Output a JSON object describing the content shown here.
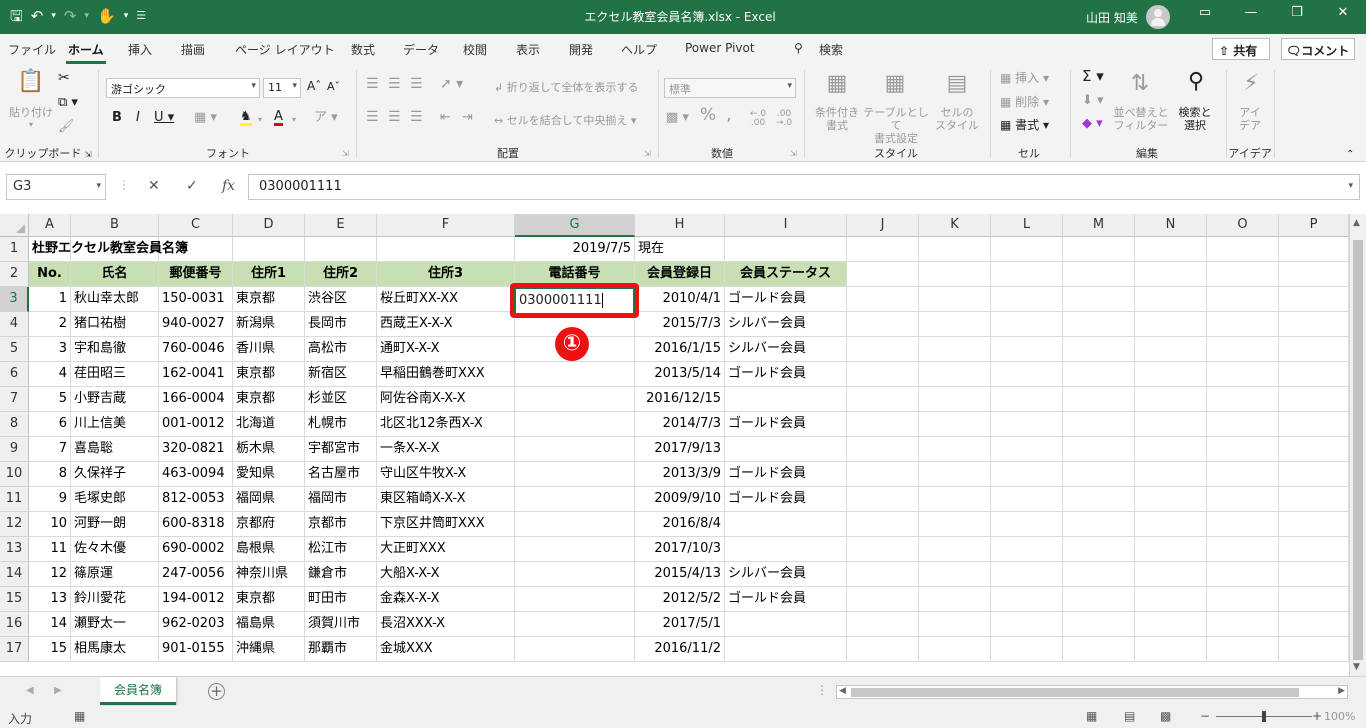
{
  "titlebar": {
    "title": "エクセル教室会員名簿.xlsx  -  Excel",
    "user": "山田 知美",
    "qat_icons": [
      "save-icon",
      "undo-icon",
      "redo-icon",
      "touch-mode-icon",
      "customize-icon"
    ]
  },
  "tabs": [
    "ファイル",
    "ホーム",
    "挿入",
    "描画",
    "ページ レイアウト",
    "数式",
    "データ",
    "校閲",
    "表示",
    "開発",
    "ヘルプ",
    "Power Pivot",
    "検索"
  ],
  "share_label": "共有",
  "comment_label": "コメント",
  "ribbon": {
    "groups": [
      "クリップボード",
      "フォント",
      "配置",
      "数値",
      "スタイル",
      "セル",
      "編集",
      "アイデア"
    ],
    "paste": "貼り付け",
    "font_name": "游ゴシック",
    "font_size": "11",
    "wrap_text": "折り返して全体を表示する",
    "merge_center": "セルを結合して中央揃え",
    "number_format": "標準",
    "conditional_format": "条件付き\n書式",
    "format_as_table": "テーブルとして\n書式設定",
    "cell_styles": "セルの\nスタイル",
    "insert": "挿入",
    "delete": "削除",
    "format": "書式",
    "sort_filter": "並べ替えと\nフィルター",
    "find_select": "検索と\n選択",
    "ideas": "アイ\nデア"
  },
  "formula_bar": {
    "name_box": "G3",
    "formula": "0300001111"
  },
  "columns": [
    "A",
    "B",
    "C",
    "D",
    "E",
    "F",
    "G",
    "H",
    "I",
    "J",
    "K",
    "L",
    "M",
    "N",
    "O",
    "P"
  ],
  "rows": [
    "1",
    "2",
    "3",
    "4",
    "5",
    "6",
    "7",
    "8",
    "9",
    "10",
    "11",
    "12",
    "13",
    "14",
    "15",
    "16",
    "17"
  ],
  "sheet": {
    "title": "杜野エクセル教室会員名簿",
    "date": "2019/7/5",
    "date_suffix": "現在",
    "headers": [
      "No.",
      "氏名",
      "郵便番号",
      "住所1",
      "住所2",
      "住所3",
      "電話番号",
      "会員登録日",
      "会員ステータス"
    ],
    "records": [
      [
        "1",
        "秋山幸太郎",
        "150-0031",
        "東京都",
        "渋谷区",
        "桜丘町XX-XX",
        "0300001111",
        "2010/4/1",
        "ゴールド会員"
      ],
      [
        "2",
        "猪口祐樹",
        "940-0027",
        "新潟県",
        "長岡市",
        "西蔵王X-X-X",
        "",
        "2015/7/3",
        "シルバー会員"
      ],
      [
        "3",
        "宇和島徹",
        "760-0046",
        "香川県",
        "高松市",
        "通町X-X-X",
        "",
        "2016/1/15",
        "シルバー会員"
      ],
      [
        "4",
        "荏田昭三",
        "162-0041",
        "東京都",
        "新宿区",
        "早稲田鶴巻町XXX",
        "",
        "2013/5/14",
        "ゴールド会員"
      ],
      [
        "5",
        "小野吉蔵",
        "166-0004",
        "東京都",
        "杉並区",
        "阿佐谷南X-X-X",
        "",
        "2016/12/15",
        ""
      ],
      [
        "6",
        "川上信美",
        "001-0012",
        "北海道",
        "札幌市",
        "北区北12条西X-X",
        "",
        "2014/7/3",
        "ゴールド会員"
      ],
      [
        "7",
        "喜島聡",
        "320-0821",
        "栃木県",
        "宇都宮市",
        "一条X-X-X",
        "",
        "2017/9/13",
        ""
      ],
      [
        "8",
        "久保祥子",
        "463-0094",
        "愛知県",
        "名古屋市",
        "守山区牛牧X-X",
        "",
        "2013/3/9",
        "ゴールド会員"
      ],
      [
        "9",
        "毛塚史郎",
        "812-0053",
        "福岡県",
        "福岡市",
        "東区箱崎X-X-X",
        "",
        "2009/9/10",
        "ゴールド会員"
      ],
      [
        "10",
        "河野一朗",
        "600-8318",
        "京都府",
        "京都市",
        "下京区井筒町XXX",
        "",
        "2016/8/4",
        ""
      ],
      [
        "11",
        "佐々木優",
        "690-0002",
        "島根県",
        "松江市",
        "大正町XXX",
        "",
        "2017/10/3",
        ""
      ],
      [
        "12",
        "篠原運",
        "247-0056",
        "神奈川県",
        "鎌倉市",
        "大船X-X-X",
        "",
        "2015/4/13",
        "シルバー会員"
      ],
      [
        "13",
        "鈴川愛花",
        "194-0012",
        "東京都",
        "町田市",
        "金森X-X-X",
        "",
        "2012/5/2",
        "ゴールド会員"
      ],
      [
        "14",
        "瀬野太一",
        "962-0203",
        "福島県",
        "須賀川市",
        "長沼XXX-X",
        "",
        "2017/5/1",
        ""
      ],
      [
        "15",
        "相馬康太",
        "901-0155",
        "沖縄県",
        "那覇市",
        "金城XXX",
        "",
        "2016/11/2",
        ""
      ]
    ]
  },
  "active_cell_value": "0300001111",
  "annotation_badge": "①",
  "sheet_tab": "会員名簿",
  "status": {
    "mode": "入力",
    "zoom": "100%"
  },
  "colors": {
    "accent": "#217346",
    "header_fill": "#c6e0b4",
    "highlight": "#ee1111"
  }
}
